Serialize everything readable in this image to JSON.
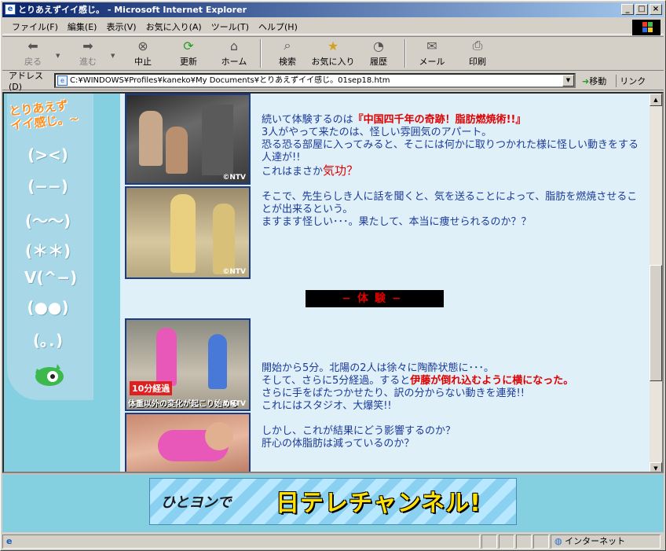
{
  "window": {
    "title": "とりあえずイイ感じ。 - Microsoft Internet Explorer",
    "minimize": "_",
    "maximize": "□",
    "close": "×"
  },
  "menu": [
    "ファイル(F)",
    "編集(E)",
    "表示(V)",
    "お気に入り(A)",
    "ツール(T)",
    "ヘルプ(H)"
  ],
  "toolbar": {
    "back": "戻る",
    "forward": "進む",
    "stop": "中止",
    "refresh": "更新",
    "home": "ホーム",
    "search": "検索",
    "favorites": "お気に入り",
    "history": "履歴",
    "mail": "メール",
    "print": "印刷"
  },
  "address": {
    "label": "アドレス(D)",
    "value": "C:¥WINDOWS¥Profiles¥kaneko¥My Documents¥とりあえずイイ感じ。01sep18.htm",
    "go": "移動",
    "links": "リンク"
  },
  "sidebar": {
    "logo_line1": "とりあえず",
    "logo_line2": "イイ感じ。~",
    "emotes": [
      "(><)",
      "(−−)",
      "(〜〜)",
      "(＊＊)",
      "V(^−)",
      "(●●)",
      "(。．)"
    ]
  },
  "content": {
    "ntv": "©NTV",
    "block1": {
      "intro": "続いて体験するのは",
      "highlight": "『中国四千年の奇跡！脂肪燃焼術!!』",
      "line2": "3人がやって来たのは、怪しい雰囲気のアパート。",
      "line3": "恐る恐る部屋に入ってみると、そこには何かに取りつかれた様に怪しい動きをする人達が!!",
      "line4a": "これはまさか",
      "line4b": "気功？",
      "line5": "そこで、先生らしき人に話を聞くと、気を送ることによって、脂肪を燃焼させることが出来るという。",
      "line6": "ますます怪しい･･･。果たして、本当に痩せられるのか？？"
    },
    "heading": "−体験−",
    "caption_badge": "10分経過",
    "caption_sub": "体重以外の変化が起こり始める",
    "block2": {
      "line1": "開始から5分。北陽の2人は徐々に陶酔状態に･･･。",
      "line2a": "そして、さらに5分経過。すると",
      "line2b": "伊藤が倒れ込むように横になった。",
      "line3": "さらに手をばたつかせたり、訳の分からない動きを連発!!",
      "line4": "これにはスタジオ、大爆笑!!",
      "line5": "しかし、これが結果にどう影響するのか？",
      "line6": "肝心の体脂肪は減っているのか？"
    }
  },
  "banner": {
    "left": "ひとヨンで",
    "right": "日テレチャンネル!"
  },
  "status": {
    "zone": "インターネット"
  }
}
